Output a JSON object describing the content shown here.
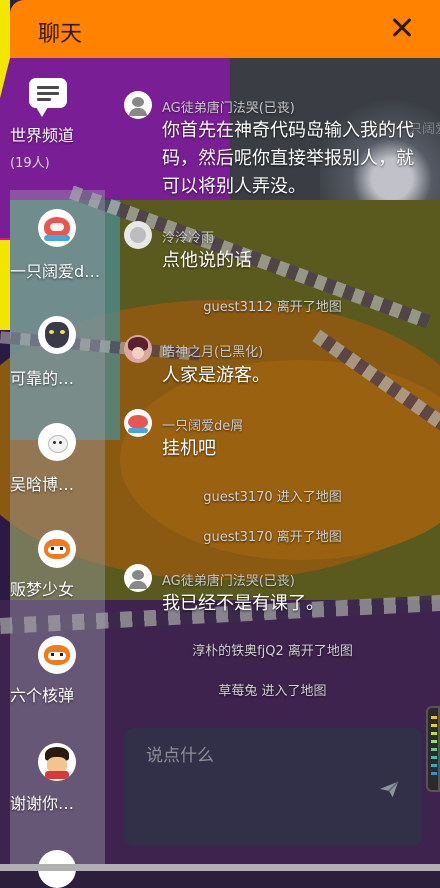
{
  "header": {
    "title": "聊天"
  },
  "background": {
    "watermark": "一只阔爱de屑"
  },
  "sidebar": {
    "channels": [
      {
        "name": "世界频道",
        "count": "(19人)",
        "icon": "chat-bubble-icon"
      },
      {
        "name": "一只阔爱de屑",
        "icon": "shark-avatar"
      },
      {
        "name": "可靠的…",
        "icon": "wolf-avatar"
      },
      {
        "name": "吴晗博…",
        "icon": "bunny-avatar"
      },
      {
        "name": "贩梦少女",
        "icon": "fox-avatar"
      },
      {
        "name": "六个核弹",
        "icon": "fox-avatar"
      },
      {
        "name": "谢谢你…",
        "icon": "ninja-avatar"
      }
    ]
  },
  "messages": [
    {
      "type": "chat",
      "user": "AG徒弟唐门法哭(已丧)",
      "text": "你首先在神奇代码岛输入我的代码，然后呢你直接举报别人，就可以将别人弄没。"
    },
    {
      "type": "chat",
      "user": "泠泠冷雨",
      "text": "点他说的话"
    },
    {
      "type": "system",
      "text": "guest3112 离开了地图"
    },
    {
      "type": "chat",
      "user": "皓神之月(已黑化)",
      "text": "人家是游客。"
    },
    {
      "type": "chat",
      "user": "一只阔爱de屑",
      "text": "挂机吧"
    },
    {
      "type": "system",
      "text": "guest3170 进入了地图"
    },
    {
      "type": "system",
      "text": "guest3170 离开了地图"
    },
    {
      "type": "chat",
      "user": "AG徒弟唐门法哭(已丧)",
      "text": "我已经不是有课了。"
    },
    {
      "type": "system",
      "text": "淳朴的铁奥fjQ2 离开了地图"
    },
    {
      "type": "system",
      "text": "草莓兔 进入了地图"
    }
  ],
  "input": {
    "placeholder": "说点什么",
    "value": ""
  },
  "colors": {
    "header": "#ff8200",
    "text": "#ffffff",
    "system": "#d2d2d2"
  }
}
